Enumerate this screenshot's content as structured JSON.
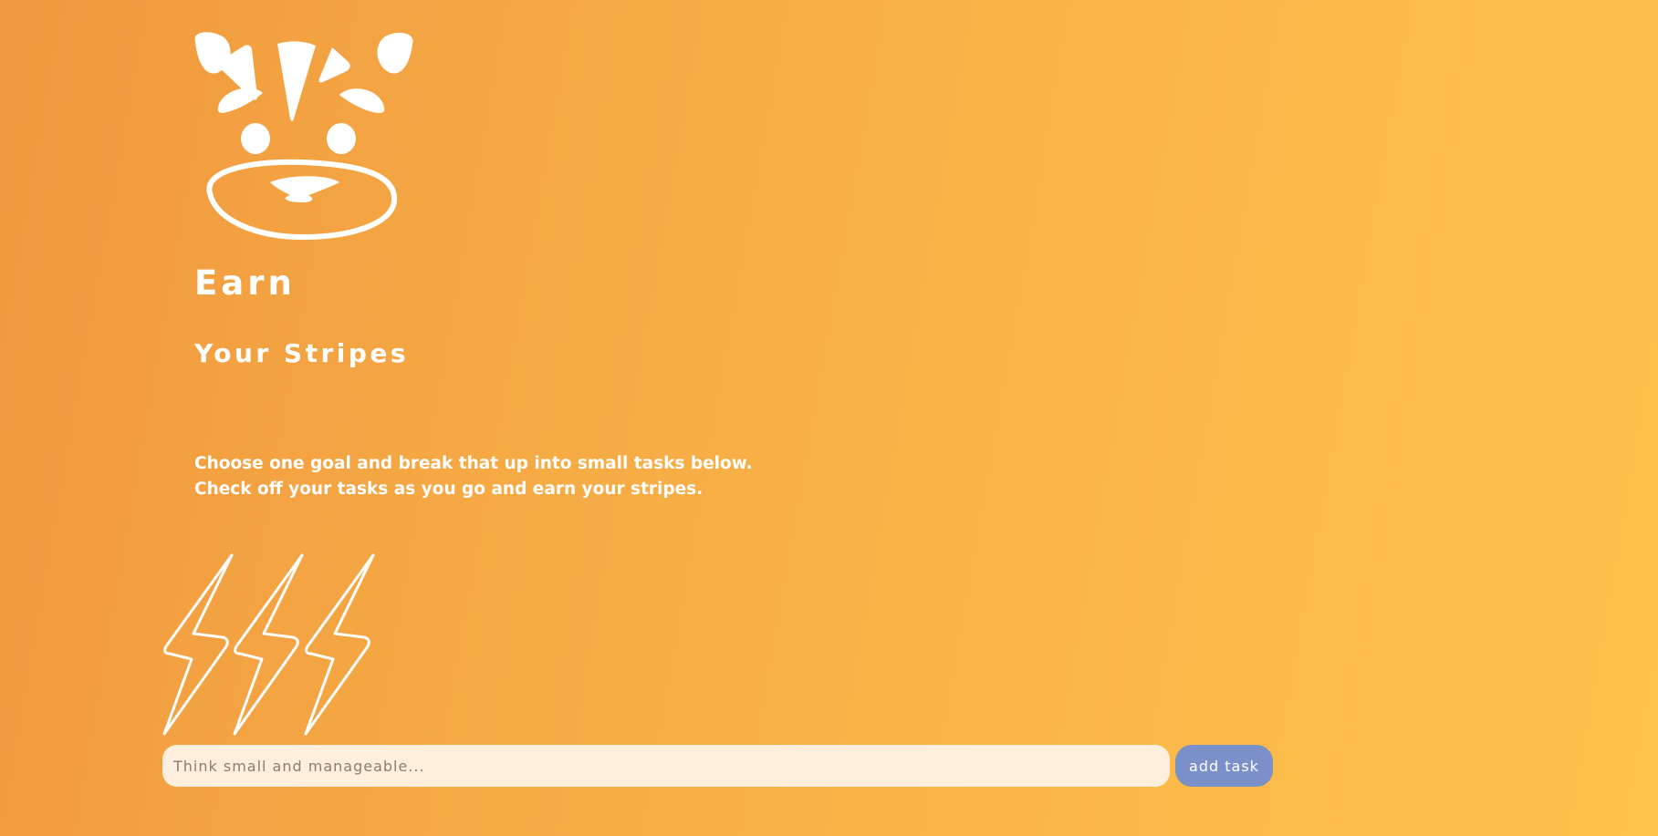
{
  "header": {
    "logo_icon": "tiger-face-icon",
    "title_line1": "Earn",
    "title_line2": "Your Stripes"
  },
  "intro": {
    "line1": "Choose one goal and break that up into small tasks below.",
    "line2": "Check off your tasks as you go and earn your stripes."
  },
  "decoration": {
    "icon": "lightning-bolts-icon"
  },
  "task_form": {
    "input_value": "",
    "placeholder": "Think small and manageable...",
    "add_label": "add task"
  },
  "colors": {
    "gradient_start": "#f0983e",
    "gradient_end": "#ffc24a",
    "input_bg": "#fdefdb",
    "button_bg": "#7b90c9",
    "text": "#ffffff"
  }
}
